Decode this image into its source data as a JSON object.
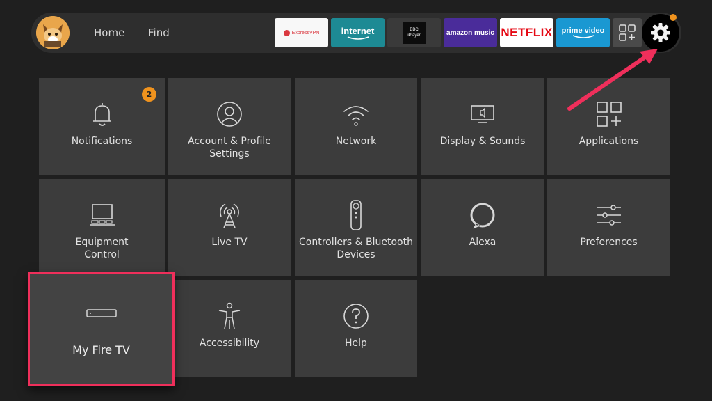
{
  "topbar": {
    "nav": [
      {
        "label": "Home"
      },
      {
        "label": "Find"
      }
    ],
    "apps": [
      {
        "name": "ExpressVPN",
        "label": "ExpressVPN",
        "bg": "#f8f8f8",
        "fg": "#da3940"
      },
      {
        "name": "internet",
        "label": "internet",
        "bg": "#1d8a94",
        "fg": "#ffffff"
      },
      {
        "name": "BBC iPlayer",
        "label": "BBC iPlayer",
        "bg": "#3a3a3a",
        "fg": "#ffffff"
      },
      {
        "name": "amazon music",
        "label": "amazon music",
        "bg": "#4a2c9a",
        "fg": "#ffffff"
      },
      {
        "name": "NETFLIX",
        "label": "NETFLIX",
        "bg": "#ffffff",
        "fg": "#e50914"
      },
      {
        "name": "prime video",
        "label": "prime video",
        "bg": "#1a98d2",
        "fg": "#ffffff"
      }
    ],
    "icons": {
      "apps": "app-grid-icon",
      "settings": "gear-icon"
    },
    "settings_notification": true
  },
  "tiles": [
    {
      "id": "notifications",
      "label": "Notifications",
      "icon": "bell-icon",
      "badge": "2"
    },
    {
      "id": "account",
      "label": "Account & Profile Settings",
      "icon": "profile-icon"
    },
    {
      "id": "network",
      "label": "Network",
      "icon": "wifi-icon"
    },
    {
      "id": "display",
      "label": "Display & Sounds",
      "icon": "display-icon"
    },
    {
      "id": "applications",
      "label": "Applications",
      "icon": "apps-icon"
    },
    {
      "id": "equipment",
      "label": "Equipment Control",
      "icon": "tv-equipment-icon"
    },
    {
      "id": "livetv",
      "label": "Live TV",
      "icon": "antenna-icon"
    },
    {
      "id": "controllers",
      "label": "Controllers & Bluetooth Devices",
      "icon": "remote-icon"
    },
    {
      "id": "alexa",
      "label": "Alexa",
      "icon": "alexa-icon"
    },
    {
      "id": "preferences",
      "label": "Preferences",
      "icon": "sliders-icon"
    },
    {
      "id": "myfiretv",
      "label": "My Fire TV",
      "icon": "fire-tv-device-icon",
      "focused": true
    },
    {
      "id": "accessibility",
      "label": "Accessibility",
      "icon": "accessibility-icon"
    },
    {
      "id": "help",
      "label": "Help",
      "icon": "help-icon"
    }
  ],
  "colors": {
    "background": "#1f1f1f",
    "tile": "#3c3c3c",
    "focus_border": "#ef2f5b",
    "badge": "#f0931e",
    "annotation_arrow": "#ef2f5b"
  }
}
